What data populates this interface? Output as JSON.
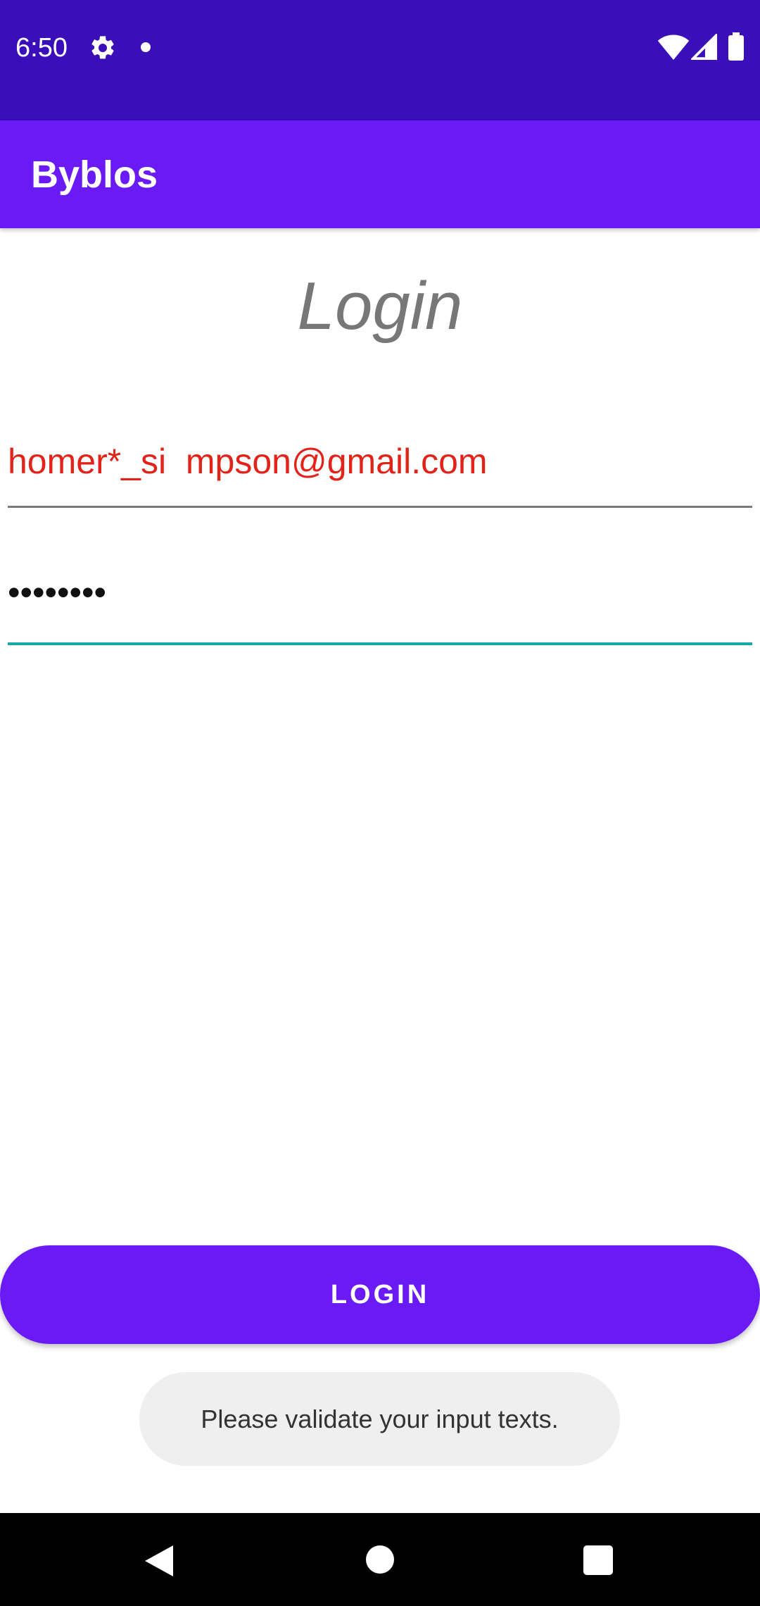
{
  "status_bar": {
    "time": "6:50",
    "icons": [
      "gear-icon",
      "notification-dot-icon",
      "wifi-icon",
      "cell-signal-icon",
      "battery-icon"
    ]
  },
  "app_bar": {
    "title": "Byblos"
  },
  "login_form": {
    "heading": "Login",
    "email_value": "homer*_si  mpson@gmail.com",
    "password_masked": "••••••••"
  },
  "login_button": {
    "label": "LOGIN"
  },
  "toast": {
    "message": "Please validate your input texts."
  },
  "nav_bar": {
    "icons": [
      "back-icon",
      "home-icon",
      "recents-icon"
    ]
  },
  "colors": {
    "status_bar": "#3a0fb9",
    "primary": "#6a1af4",
    "error_text": "#e2231a",
    "focused_underline": "#1aa7a7",
    "toast_background": "#efefef"
  }
}
